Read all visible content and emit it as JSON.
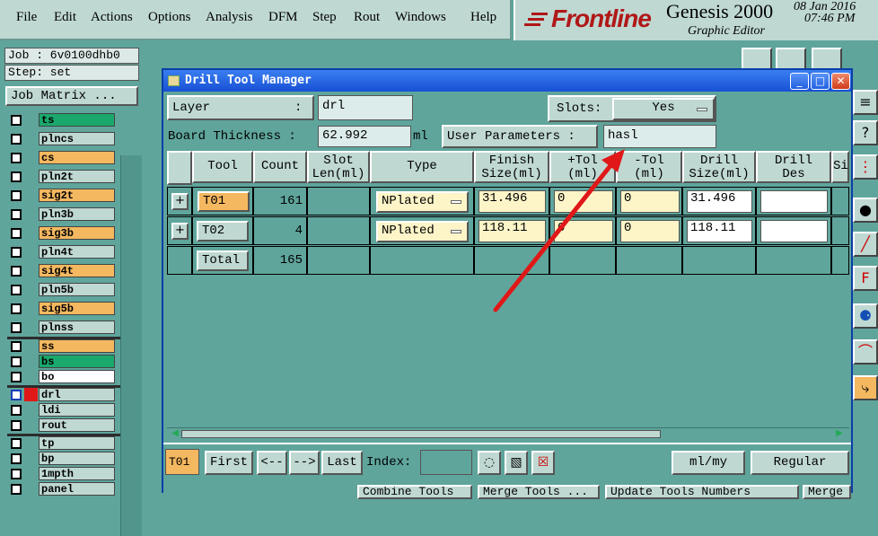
{
  "menu": [
    "File",
    "Edit",
    "Actions",
    "Options",
    "Analysis",
    "DFM",
    "Step",
    "Rout",
    "Windows",
    "Help"
  ],
  "brand": {
    "logo": "Frontline",
    "product": "Genesis 2000",
    "subtitle": "Graphic Editor",
    "date": "08 Jan 2016",
    "time": "07:46 PM"
  },
  "left": {
    "job": "Job : 6v0100dhb0",
    "step": "Step: set",
    "job_matrix": "Job Matrix ..."
  },
  "layers": [
    {
      "name": "ts",
      "color": "#1aa86c"
    },
    {
      "name": "plncs",
      "color": "#bfd8d2"
    },
    {
      "name": "cs",
      "color": "#f4b860"
    },
    {
      "name": "pln2t",
      "color": "#bfd8d2"
    },
    {
      "name": "sig2t",
      "color": "#f4b860"
    },
    {
      "name": "pln3b",
      "color": "#bfd8d2"
    },
    {
      "name": "sig3b",
      "color": "#f4b860"
    },
    {
      "name": "pln4t",
      "color": "#bfd8d2"
    },
    {
      "name": "sig4t",
      "color": "#f4b860"
    },
    {
      "name": "pln5b",
      "color": "#bfd8d2"
    },
    {
      "name": "sig5b",
      "color": "#f4b860"
    },
    {
      "name": "plnss",
      "color": "#bfd8d2"
    },
    {
      "name": "ss",
      "color": "#f4b860"
    },
    {
      "name": "bs",
      "color": "#1aa86c"
    },
    {
      "name": "bo",
      "color": "#ffffff"
    },
    {
      "name": "drl",
      "color": "#bfd8d2"
    },
    {
      "name": "ldi",
      "color": "#bfd8d2"
    },
    {
      "name": "rout",
      "color": "#bfd8d2"
    },
    {
      "name": "tp",
      "color": "#bfd8d2"
    },
    {
      "name": "bp",
      "color": "#bfd8d2"
    },
    {
      "name": "1mpth",
      "color": "#bfd8d2"
    },
    {
      "name": "panel",
      "color": "#bfd8d2"
    }
  ],
  "dialog": {
    "title": "Drill Tool Manager",
    "layer_label": "Layer",
    "layer_sep": ":",
    "layer_value": "drl",
    "slots_label": "Slots:",
    "slots_value": "Yes",
    "board_thickness_label": "Board Thickness :",
    "board_thickness_value": "62.992",
    "board_unit": "ml",
    "user_params_label": "User Parameters :",
    "user_params_value": "hasl",
    "columns": [
      "Tool",
      "Count",
      "Slot\nLen(ml)",
      "Type",
      "Finish\nSize(ml)",
      "+Tol\n(ml)",
      "-Tol\n(ml)",
      "Drill\nSize(ml)",
      "Drill\nDes",
      "Si"
    ],
    "rows": [
      {
        "tool": "T01",
        "count": "161",
        "slot_len": "",
        "type": "NPlated",
        "finish": "31.496",
        "ptol": "0",
        "mtol": "0",
        "drill": "31.496",
        "des": ""
      },
      {
        "tool": "T02",
        "count": "4",
        "slot_len": "",
        "type": "NPlated",
        "finish": "118.11",
        "ptol": "0",
        "mtol": "0",
        "drill": "118.11",
        "des": ""
      }
    ],
    "total_label": "Total",
    "total_count": "165",
    "bottom": {
      "current": "T01",
      "first": "First",
      "prev": "<--",
      "next": "-->",
      "last": "Last",
      "index_label": "Index:",
      "units": "ml/my",
      "mode": "Regular"
    },
    "bottom2": [
      "Combine Tools",
      "Merge Tools ...",
      "Update Tools Numbers",
      "Merge"
    ]
  }
}
